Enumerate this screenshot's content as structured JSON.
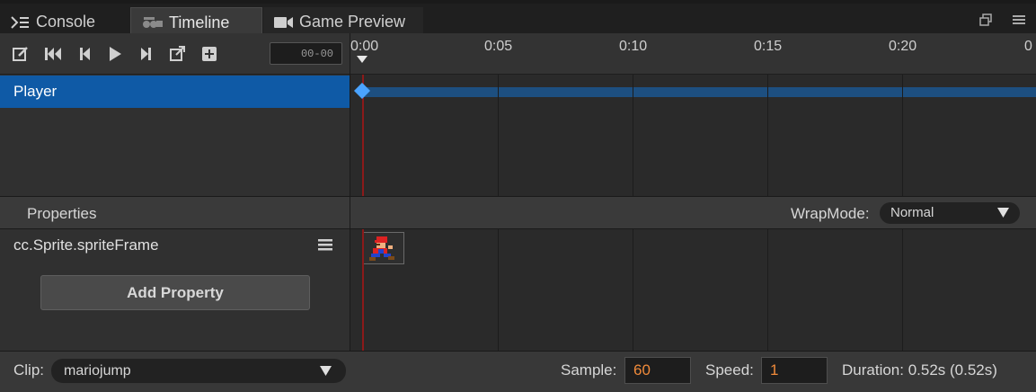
{
  "tabs": [
    {
      "label": "Console",
      "icon": "console-icon",
      "active": false
    },
    {
      "label": "Timeline",
      "icon": "timeline-icon",
      "active": true
    },
    {
      "label": "Game Preview",
      "icon": "video-camera-icon",
      "active": false
    }
  ],
  "window_controls": {
    "restore_icon": "restore-window-icon",
    "menu_icon": "hamburger-menu-icon"
  },
  "toolbar": {
    "buttons": [
      "edit-icon",
      "jump-to-start-icon",
      "previous-frame-icon",
      "play-icon",
      "next-frame-icon",
      "export-icon",
      "add-icon"
    ],
    "current_time": "00-00"
  },
  "ruler": {
    "labels": [
      "0:00",
      "0:05",
      "0:10",
      "0:15",
      "0:20",
      "0"
    ]
  },
  "nodes": [
    {
      "name": "Player",
      "selected": true
    }
  ],
  "properties": {
    "title": "Properties",
    "wrap_mode_label": "WrapMode:",
    "wrap_mode_value": "Normal",
    "items": [
      {
        "name": "cc.Sprite.spriteFrame"
      }
    ],
    "add_button_label": "Add Property"
  },
  "footer": {
    "clip_label": "Clip:",
    "clip_value": "mariojump",
    "sample_label": "Sample:",
    "sample_value": "60",
    "speed_label": "Speed:",
    "speed_value": "1",
    "duration_text": "Duration: 0.52s (0.52s)"
  },
  "colors": {
    "selection_blue": "#0f5aa6",
    "track_bar": "#1d4f80",
    "keyframe": "#4aa3ff",
    "playhead": "#8c1a1a",
    "input_text_orange": "#f08a3a"
  }
}
